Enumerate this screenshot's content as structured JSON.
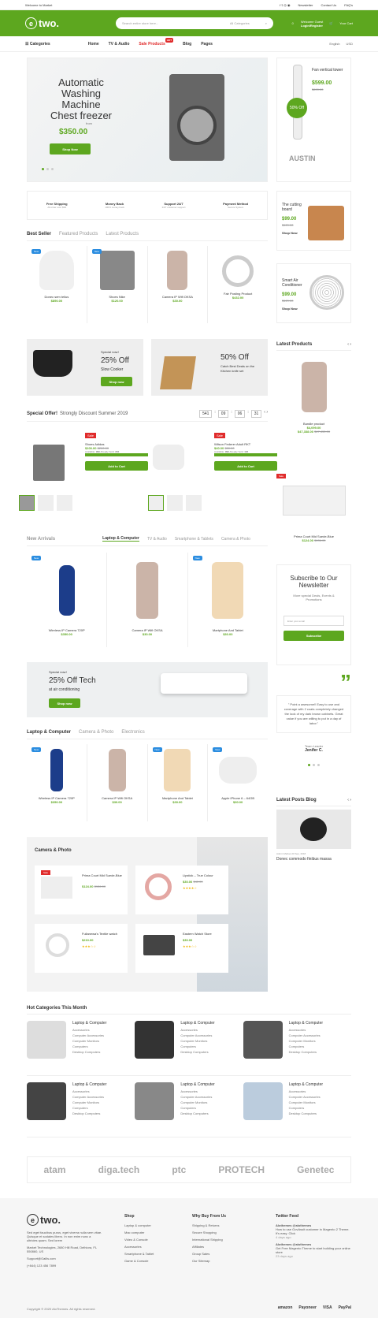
{
  "topbar": {
    "welcome": "Welcome to Market",
    "newsletter": "Newsletter",
    "contact": "Contact Us",
    "faqs": "FAQ's"
  },
  "header": {
    "brand": "two.",
    "search_placeholder": "Search entire store here...",
    "search_category": "All Categories",
    "welcome_guest": "Welcome Guest",
    "login": "Login/Register",
    "cart": "Your Cart"
  },
  "nav": {
    "categories": "Categories",
    "items": [
      "Home",
      "TV & Audio",
      "Sale Products",
      "Blog",
      "Pages"
    ],
    "hot": "HOT",
    "lang": "English",
    "currency": "USD"
  },
  "hero": {
    "title": "Automatic Washing Machine Chest freezer",
    "from": "from",
    "price": "$350.00",
    "cta": "Shop Now"
  },
  "side": [
    {
      "title": "Fan vertical tower",
      "price": "$599.00",
      "old": "$699.00",
      "badge": "50% Off"
    },
    {
      "title": "The cutting board",
      "price": "$99.00",
      "old": "$129.00",
      "cta": "Shop Now"
    },
    {
      "title": "Smart Air Conditioner",
      "price": "$99.00",
      "old": "$129.00",
      "cta": "Shop Now"
    }
  ],
  "features": [
    {
      "t": "Free Shipping",
      "s": "All order over $99"
    },
    {
      "t": "Money Back",
      "s": "100% money back"
    },
    {
      "t": "Support 24/7",
      "s": "24/7 customer support"
    },
    {
      "t": "Payment Method",
      "s": "Secure System"
    }
  ],
  "bestseller": {
    "tabs": [
      "Best Seller",
      "Featured Products",
      "Latest Products"
    ],
    "products": [
      {
        "name": "Donec sem tellus",
        "price": "$890.00",
        "new": "New"
      },
      {
        "name": "Shoes Nike",
        "price": "$120.00",
        "new": "New"
      },
      {
        "name": "Camera IP Wifi OKSA",
        "price": "$30.00"
      },
      {
        "name": "Fair Posting Product",
        "price": "$432.00"
      }
    ]
  },
  "banners": [
    {
      "small": "Special now!",
      "big": "25% Off",
      "sub": "Slow Cooker",
      "cta": "Shop now"
    },
    {
      "big": "50% Off",
      "sub": "Catch Best Deals on the Kitchen knife set"
    }
  ],
  "latest": {
    "title": "Latest Products",
    "name": "Bundle product",
    "price": "$4,099.00",
    "range": "$47,338.00",
    "old": "$47,450.00"
  },
  "special": {
    "title": "Special Offer!",
    "sub": "Strongly Discount Summer 2019",
    "timer": [
      "541",
      "09",
      "06",
      "31"
    ],
    "items": [
      {
        "sale": "Sale",
        "name": "Shoes Adidas",
        "price": "$100.00",
        "old": "$200.00",
        "avail": "999",
        "sold": "204",
        "cta": "Add to Cart"
      },
      {
        "sale": "Sale",
        "name": "Wilson Federer Adult RKT",
        "price": "$40.00",
        "old": "$50.00",
        "avail": "999",
        "sold": "122",
        "cta": "Add to Cart"
      }
    ],
    "avail_label": "Available:",
    "sold_label": "Already Sold:"
  },
  "sale_side": {
    "sale": "Sale",
    "name": "Prima Court Mid Suede-Blue",
    "price": "$124.00",
    "old": "$136.00"
  },
  "newarrivals": {
    "title": "New Arrivals",
    "tabs": [
      "Laptop & Computer",
      "TV & Audio",
      "Smartphone & Tablets",
      "Camera & Photo"
    ],
    "products": [
      {
        "name": "Wireless IP Camera 720P",
        "price": "$350.00",
        "new": "New"
      },
      {
        "name": "Camera IP Wifi OKSA",
        "price": "$30.00"
      },
      {
        "name": "Martphone And Tablet",
        "price": "$30.00",
        "new": "New"
      }
    ]
  },
  "subscribe": {
    "title": "Subscribe to Our Newsletter",
    "sub": "More special Deals, Events & Promotions",
    "placeholder": "Enter your email",
    "cta": "Subscribe"
  },
  "ac_banner": {
    "small": "Special now!",
    "big": "25% Off Tech",
    "sub": "at air conditioning",
    "cta": "Shop now"
  },
  "testimonial": {
    "text": "\" Point a awesome!! Easy to use and coverage with 2 coats completely changed the look of my dark brown cabinets. Great value if you are willing to put in a day of labor.\"",
    "role": "Team Leader",
    "name": "Jenifer C."
  },
  "laptop": {
    "tabs": [
      "Laptop & Computer",
      "Camera & Photo",
      "Electronics"
    ],
    "products": [
      {
        "name": "Wireless IP Camera 720P",
        "price": "$350.00",
        "new": "New"
      },
      {
        "name": "Camera IP Wifi OKSA",
        "price": "$30.00"
      },
      {
        "name": "Martphone And Tablet",
        "price": "$30.00",
        "new": "New"
      },
      {
        "name": "Apple iPhone 6 – 64GB",
        "price": "$30.00",
        "new": "New"
      }
    ]
  },
  "posts": {
    "title": "Latest Posts Blog",
    "meta": "Admin Market  20 Sep, 2018",
    "heading": "Donec commodo finibus massa"
  },
  "camera": {
    "title": "Camera & Photo",
    "items": [
      {
        "name": "Prima Court Mid Suede-Blue",
        "price": "$124.00",
        "old": "$136.00",
        "sale": "Sale"
      },
      {
        "name": "Lipstick – True Colour",
        "price": "$30.00",
        "old": "$40.00"
      },
      {
        "name": "Fullanewa's Textile watch",
        "price": "$210.00"
      },
      {
        "name": "Eastern Watch Store",
        "price": "$30.00"
      }
    ]
  },
  "hotcats": {
    "title": "Hot Categories This Month",
    "cat": "Laptop & Computer",
    "subs": [
      "Accessories",
      "Computer Accessories",
      "Computer Monitors",
      "Computers",
      "Desktop Computers"
    ]
  },
  "brands": [
    "atam",
    "diga.tech",
    "ptc",
    "PROTECH",
    "Genetec"
  ],
  "footer": {
    "about": "Sed eget faucibus purus, eget viverra nulla sem vitae. Quisque et sodales libero. In non enim nunc a ultricies quam. Sed lorem",
    "addr": "Market Technologies, 2680 Hill Road, Delhiora, FL 550860, US",
    "email": "Support@Gaills.com",
    "phone": "(+844) 123 456 7899",
    "shop": {
      "title": "Shop",
      "links": [
        "Laptop & computer",
        "Mac computer",
        "Video & Console",
        "Accessories",
        "Smartphone & Tablet",
        "Game & Console"
      ]
    },
    "why": {
      "title": "Why Buy From Us",
      "links": [
        "Shipping & Returns",
        "Secure Shopping",
        "International Shipping",
        "Affiliates",
        "Group Sales",
        "Our Sitemap"
      ]
    },
    "twitter": {
      "title": "Twitter Feed",
      "items": [
        {
          "user": "Alothemes @alothemes",
          "text": "How to use GovAssit customer in Magento 2 Theme. It's easy. Click",
          "time": "4 days ago"
        },
        {
          "user": "Alothemes @alothemes",
          "text": "Get Free Magento Theme to start building your online store",
          "time": "23 days ago"
        }
      ]
    },
    "copy": "Copyright © 2020 AloThemes. All rights reserved.",
    "pay": [
      "amazon",
      "Payoneer",
      "VISA",
      "PayPal"
    ]
  }
}
